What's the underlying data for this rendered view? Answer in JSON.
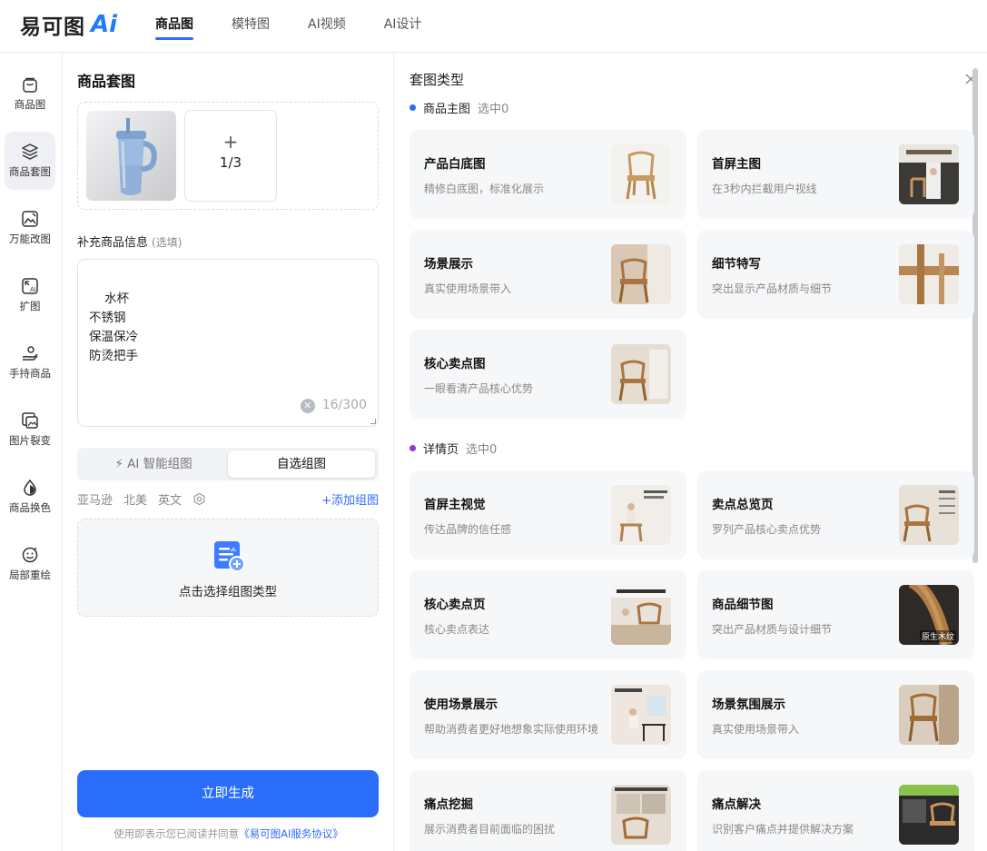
{
  "app": {
    "logo_text": "易可图",
    "logo_ai": "Ai"
  },
  "nav": {
    "tabs": [
      {
        "label": "商品图",
        "active": true
      },
      {
        "label": "模特图",
        "active": false
      },
      {
        "label": "AI视频",
        "active": false
      },
      {
        "label": "AI设计",
        "active": false
      }
    ]
  },
  "sidebar": {
    "items": [
      {
        "label": "商品图",
        "icon": "shopping-bag-icon",
        "active": false
      },
      {
        "label": "商品套图",
        "icon": "layers-icon",
        "active": true
      },
      {
        "label": "万能改图",
        "icon": "image-edit-icon",
        "active": false
      },
      {
        "label": "扩图",
        "icon": "expand-ai-icon",
        "active": false
      },
      {
        "label": "手持商品",
        "icon": "hand-hold-icon",
        "active": false
      },
      {
        "label": "图片裂变",
        "icon": "image-split-icon",
        "active": false
      },
      {
        "label": "商品换色",
        "icon": "color-drop-icon",
        "active": false
      },
      {
        "label": "局部重绘",
        "icon": "smile-redraw-icon",
        "active": false
      }
    ]
  },
  "left": {
    "title": "商品套图",
    "upload_count": "1/3",
    "info_label": "补充商品信息",
    "info_optional": "(选填)",
    "info_text": "水杯\n不锈钢\n保温保冷\n防烫把手",
    "char_count": "16/300",
    "seg_ai": "AI 智能组图",
    "seg_custom": "自选组图",
    "filters": [
      "亚马逊",
      "北美",
      "英文"
    ],
    "add_group": "+添加组图",
    "pick_label": "点击选择组图类型",
    "generate": "立即生成",
    "agree_prefix": "使用即表示您已阅读并同意",
    "agree_link": "《易可图AI服务协议》"
  },
  "right": {
    "title": "套图类型",
    "sections": [
      {
        "name": "商品主图",
        "selected": "选中0",
        "color": "#2f6bff",
        "cards": [
          {
            "title": "产品白底图",
            "desc": "精修白底图，标准化展示"
          },
          {
            "title": "首屏主图",
            "desc": "在3秒内拦截用户视线"
          },
          {
            "title": "场景展示",
            "desc": "真实使用场景带入"
          },
          {
            "title": "细节特写",
            "desc": "突出显示产品材质与细节"
          },
          {
            "title": "核心卖点图",
            "desc": "一眼看清产品核心优势"
          }
        ]
      },
      {
        "name": "详情页",
        "selected": "选中0",
        "color": "#9b2fd6",
        "cards": [
          {
            "title": "首屏主视觉",
            "desc": "传达品牌的信任感"
          },
          {
            "title": "卖点总览页",
            "desc": "罗列产品核心卖点优势"
          },
          {
            "title": "核心卖点页",
            "desc": "核心卖点表达"
          },
          {
            "title": "商品细节图",
            "desc": "突出产品材质与设计细节"
          },
          {
            "title": "使用场景展示",
            "desc": "帮助消费者更好地想象实际使用环境"
          },
          {
            "title": "场景氛围展示",
            "desc": "真实使用场景带入"
          },
          {
            "title": "痛点挖掘",
            "desc": "展示消费者目前面临的困扰"
          },
          {
            "title": "痛点解决",
            "desc": "识别客户痛点并提供解决方案"
          }
        ]
      }
    ],
    "thumb_texts": {
      "detail_wood": "原生木纹"
    }
  }
}
